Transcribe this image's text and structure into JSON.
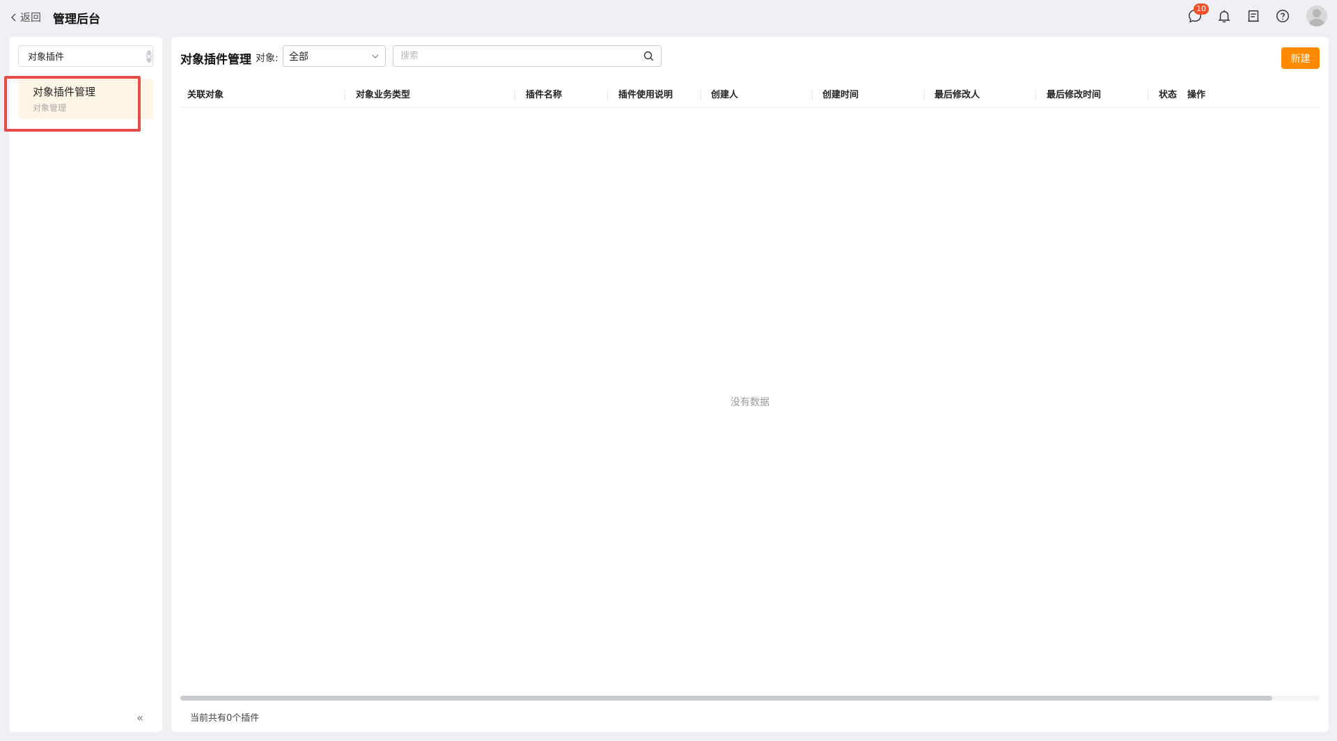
{
  "topbar": {
    "back_label": "返回",
    "title": "管理后台",
    "chat_badge": "10",
    "icons": [
      "chat-icon",
      "bell-icon",
      "inbox-icon",
      "help-icon",
      "avatar"
    ]
  },
  "sidebar": {
    "search_value": "对象插件",
    "items": [
      {
        "label": "对象插件管理",
        "sublabel": "对象管理"
      }
    ],
    "collapse_glyph": "«"
  },
  "main": {
    "page_title": "对象插件管理",
    "filter_label": "对象:",
    "filter_value": "全部",
    "search_placeholder": "搜索",
    "new_button": "新建",
    "columns": [
      "关联对象",
      "对象业务类型",
      "插件名称",
      "插件使用说明",
      "创建人",
      "创建时间",
      "最后修改人",
      "最后修改时间",
      "状态",
      "操作"
    ],
    "empty_text": "没有数据",
    "footer_count": "当前共有0个插件"
  },
  "colors": {
    "accent": "#ff8a00",
    "highlight": "#e94a4a",
    "badge": "#f0502a",
    "selected_bg": "#fff5e6"
  }
}
